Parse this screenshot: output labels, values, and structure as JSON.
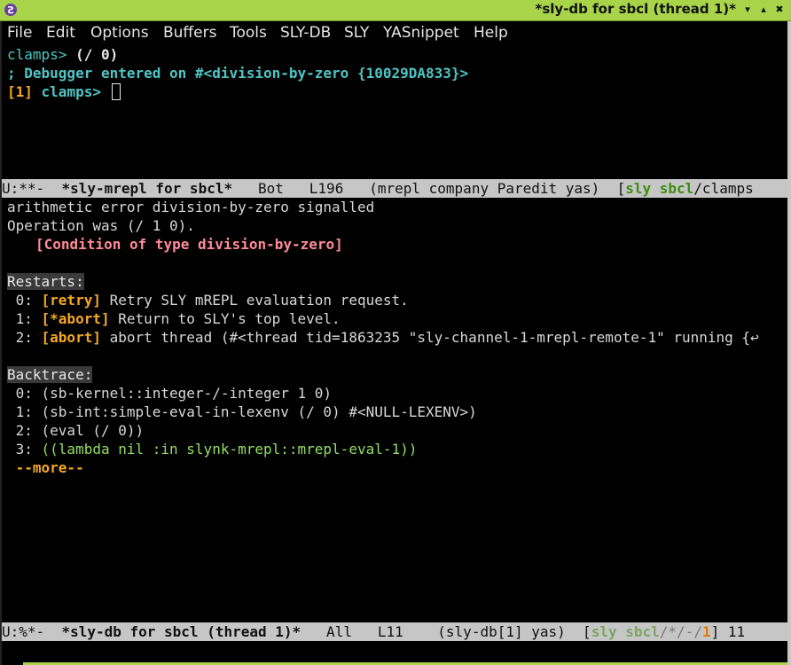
{
  "window": {
    "title": "*sly-db for sbcl (thread 1)*",
    "buttons": [
      "▾",
      "▴",
      "✖"
    ]
  },
  "menu": [
    "File",
    "Edit",
    "Options",
    "Buffers",
    "Tools",
    "SLY-DB",
    "SLY",
    "YASnippet",
    "Help"
  ],
  "repl": {
    "line1_prompt": "clamps>",
    "line1_cmd": " (/ 0)",
    "line2": "; Debugger entered on #<division-by-zero {10029DA833}>",
    "line3_level": "[1]",
    "line3_prompt": " clamps>"
  },
  "modeline_repl": {
    "status": "U:**-  ",
    "buffer": "*sly-mrepl for sbcl*",
    "pos": "   Bot   L196   ",
    "modes": "(mrepl company Paredit yas)  ",
    "sly_open": "[",
    "sly": "sly",
    "sbcl": "sbcl",
    "rest": "/clamps"
  },
  "db": {
    "error": "arithmetic error division-by-zero signalled",
    "operation": "Operation was (/ 1 0).",
    "condition": "[Condition of type division-by-zero]",
    "restarts_header": "Restarts:",
    "restarts": [
      {
        "num": " 0: ",
        "tag": "[retry]",
        "text": " Retry SLY mREPL evaluation request."
      },
      {
        "num": " 1: ",
        "tag": "[*abort]",
        "text": " Return to SLY's top level."
      },
      {
        "num": " 2: ",
        "tag": "[abort]",
        "text": " abort thread (#<thread tid=1863235 \"sly-channel-1-mrepl-remote-1\" running {↩"
      }
    ],
    "backtrace_header": "Backtrace:",
    "frames": [
      {
        "num": " 0: ",
        "text": "(sb-kernel::integer-/-integer 1 0)"
      },
      {
        "num": " 1: ",
        "text": "(sb-int:simple-eval-in-lexenv (/ 0) #<NULL-LEXENV>)"
      },
      {
        "num": " 2: ",
        "text": "(eval (/ 0))"
      },
      {
        "num": " 3: ",
        "text": "((lambda nil :in slynk-mrepl::mrepl-eval-1))"
      }
    ],
    "more": " --more--"
  },
  "modeline_db": {
    "status": "U:%*-  ",
    "buffer": "*sly-db for sbcl (thread 1)*",
    "pos": "   All   L11    ",
    "modes": "(sly-db[1] yas)  ",
    "sly_open": "[",
    "sly": "sly",
    "sbcl": "sbcl",
    "mid": "/*/-/",
    "num": "1",
    "close": "] 11"
  },
  "colors": {
    "titlebar": "#a8d44a",
    "prompt": "#4fc5c5",
    "restart_tag": "#f5a623",
    "frame_green": "#92e063",
    "condition": "#ff8a99"
  }
}
